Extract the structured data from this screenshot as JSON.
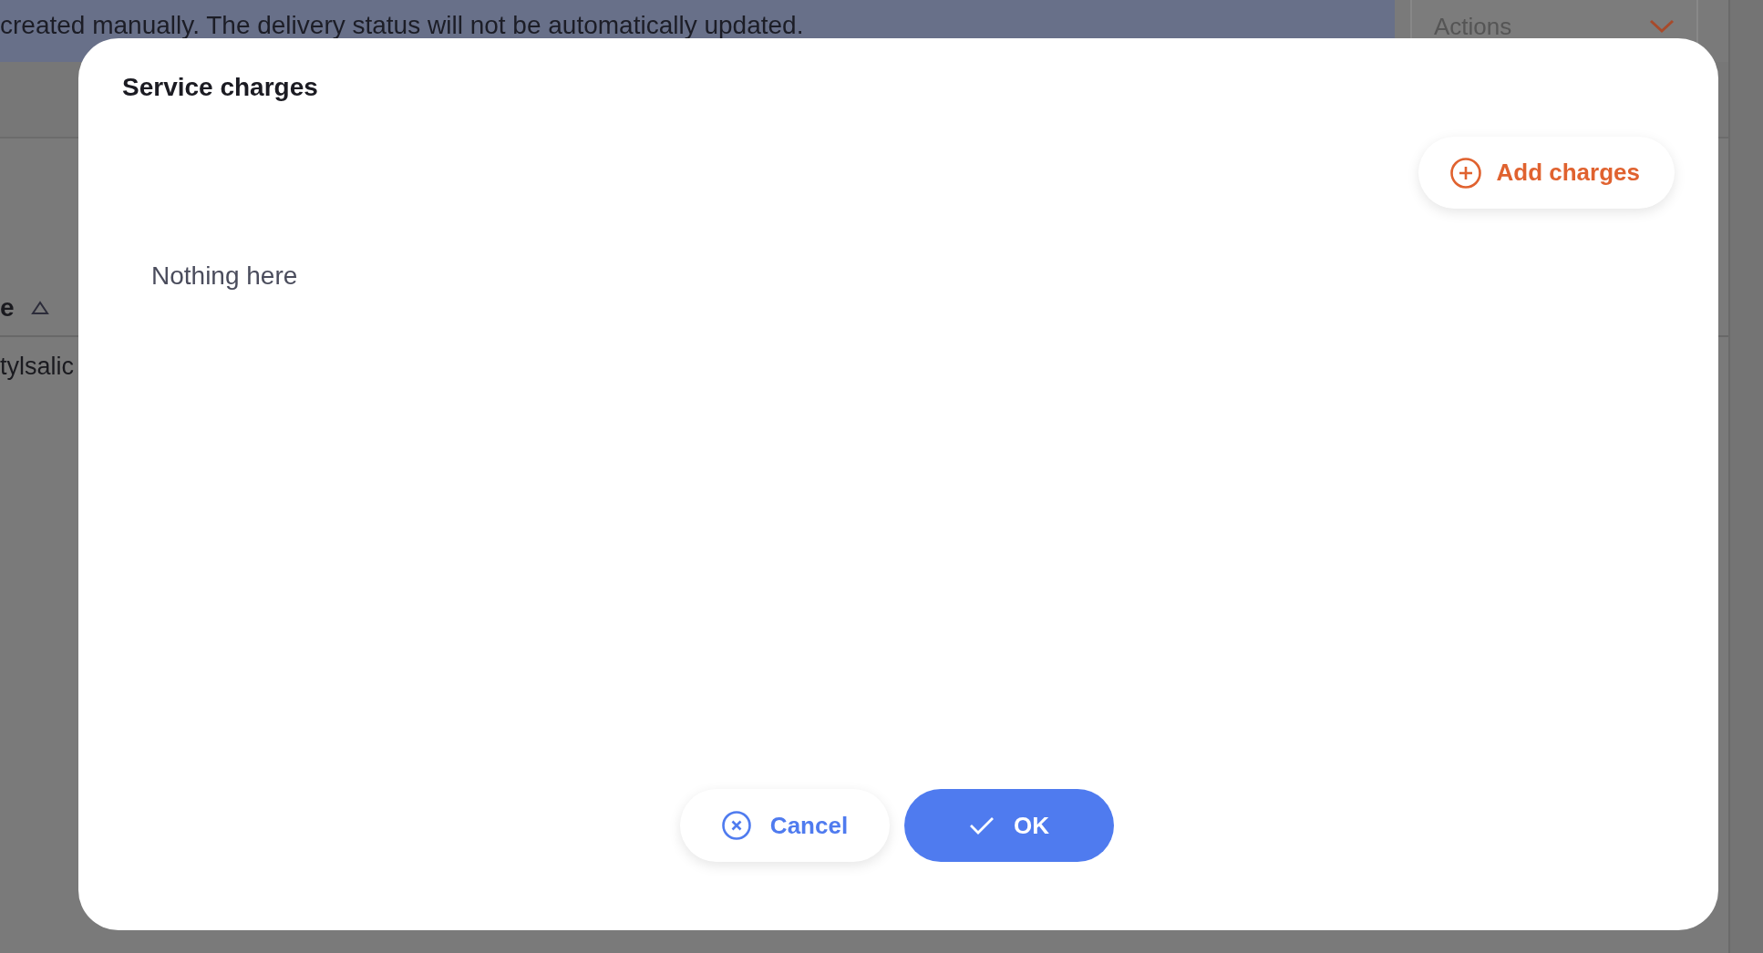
{
  "background": {
    "banner": "created manually. The delivery status will not be automatically updated.",
    "actions": {
      "label": "Actions"
    },
    "table": {
      "column": {
        "label": "e",
        "sort_ascending": true
      },
      "cell": "tylsalic"
    }
  },
  "dialog": {
    "title": "Service charges",
    "add_button": "Add charges",
    "empty_text": "Nothing here",
    "buttons": [
      {
        "kind": "cancel",
        "label": "Cancel"
      },
      {
        "kind": "ok",
        "label": "OK"
      }
    ]
  }
}
